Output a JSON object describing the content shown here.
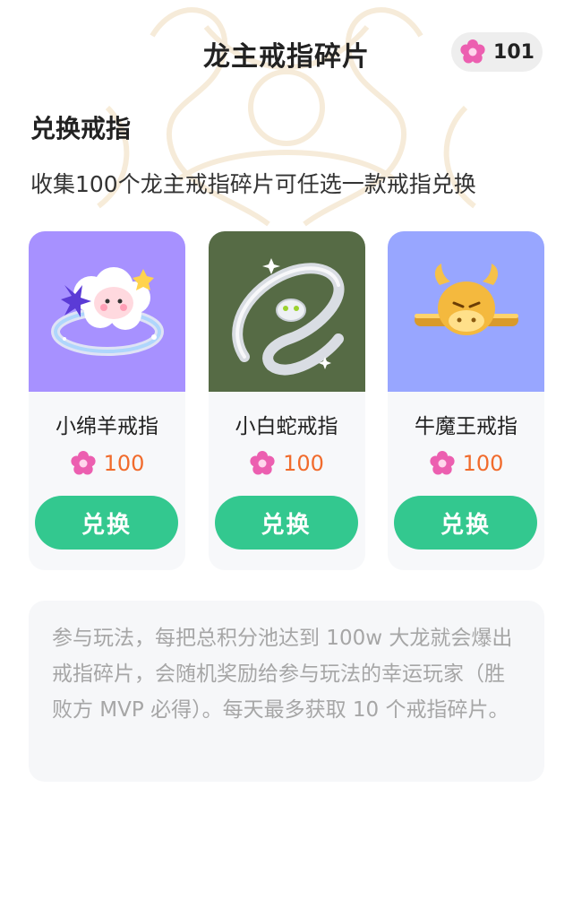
{
  "header": {
    "title": "龙主戒指碎片",
    "balance": "101",
    "balance_icon": "pink-flower-fragment-icon"
  },
  "section": {
    "title": "兑换戒指",
    "description": "收集100个龙主戒指碎片可任选一款戒指兑换"
  },
  "cards": [
    {
      "name": "小绵羊戒指",
      "price": "100",
      "button_label": "兑换",
      "bg_color": "#a791ff",
      "image_icon": "sheep-ring-icon"
    },
    {
      "name": "小白蛇戒指",
      "price": "100",
      "button_label": "兑换",
      "bg_color": "#566b45",
      "image_icon": "white-snake-ring-icon"
    },
    {
      "name": "牛魔王戒指",
      "price": "100",
      "button_label": "兑换",
      "bg_color": "#98a6ff",
      "image_icon": "bull-king-ring-icon"
    }
  ],
  "rules": {
    "text": "参与玩法，每把总积分池达到 100w 大龙就会爆出戒指碎片，会随机奖励给参与玩法的幸运玩家（胜败方 MVP 必得）。每天最多获取 10 个戒指碎片。"
  },
  "colors": {
    "accent_button": "#33c88f",
    "price": "#f16b2c",
    "rules_text": "#a6a6a6"
  }
}
